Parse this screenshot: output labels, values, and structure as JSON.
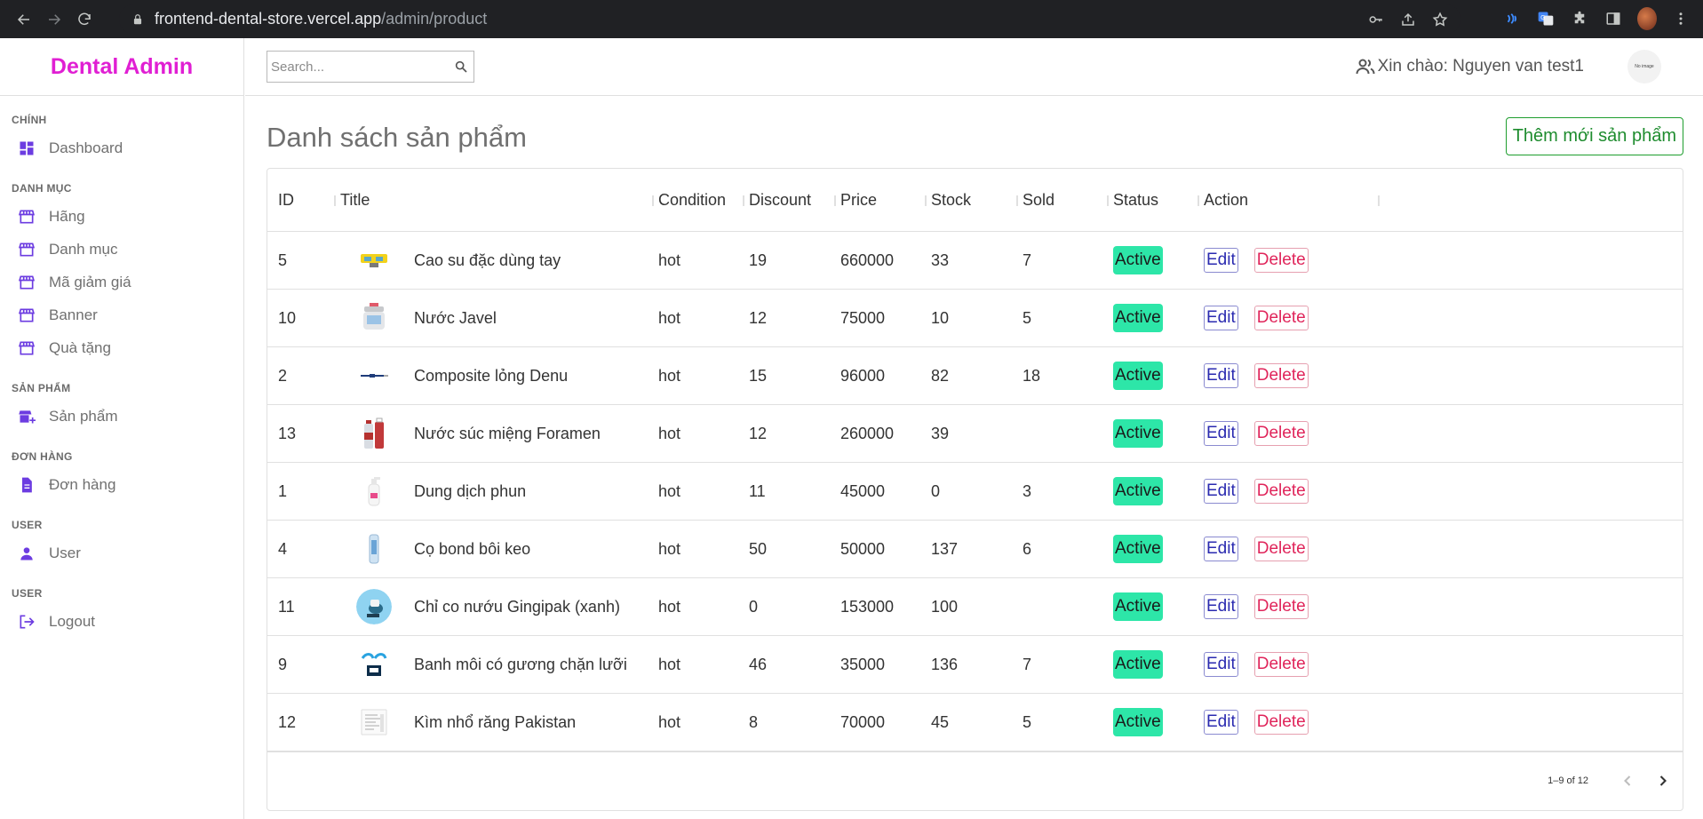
{
  "browser": {
    "url_host": "frontend-dental-store.vercel.app",
    "url_path": "/admin/product"
  },
  "brand": "Dental Admin",
  "sidebar": {
    "sections": [
      {
        "title": "CHÍNH",
        "items": [
          {
            "label": "Dashboard",
            "icon": "dashboard-icon"
          }
        ]
      },
      {
        "title": "DANH MỤC",
        "items": [
          {
            "label": "Hãng",
            "icon": "store-icon"
          },
          {
            "label": "Danh mục",
            "icon": "store-icon"
          },
          {
            "label": "Mã giảm giá",
            "icon": "store-icon"
          },
          {
            "label": "Banner",
            "icon": "store-icon"
          },
          {
            "label": "Quà tặng",
            "icon": "store-icon"
          }
        ]
      },
      {
        "title": "SẢN PHẨM",
        "items": [
          {
            "label": "Sản phẩm",
            "icon": "add-business-icon"
          }
        ]
      },
      {
        "title": "ĐƠN HÀNG",
        "items": [
          {
            "label": "Đơn hàng",
            "icon": "order-icon"
          }
        ]
      },
      {
        "title": "USER",
        "items": [
          {
            "label": "User",
            "icon": "person-icon"
          }
        ]
      },
      {
        "title": "USER",
        "items": [
          {
            "label": "Logout",
            "icon": "logout-icon"
          }
        ]
      }
    ]
  },
  "topbar": {
    "search_placeholder": "Search...",
    "greeting": "Xin chào: Nguyen van test1",
    "avatar_text": "No image"
  },
  "main": {
    "title": "Danh sách sản phẩm",
    "add_button": "Thêm mới sản phẩm"
  },
  "table": {
    "columns": [
      "ID",
      "Title",
      "Condition",
      "Discount",
      "Price",
      "Stock",
      "Sold",
      "Status",
      "Action"
    ],
    "edit_label": "Edit",
    "delete_label": "Delete",
    "rows": [
      {
        "id": "5",
        "title": "Cao su đặc dùng tay",
        "condition": "hot",
        "discount": "19",
        "price": "660000",
        "stock": "33",
        "sold": "7",
        "status": "Active",
        "thumb": "yellow"
      },
      {
        "id": "10",
        "title": "Nước Javel",
        "condition": "hot",
        "discount": "12",
        "price": "75000",
        "stock": "10",
        "sold": "5",
        "status": "Active",
        "thumb": "jar"
      },
      {
        "id": "2",
        "title": "Composite lỏng Denu",
        "condition": "hot",
        "discount": "15",
        "price": "96000",
        "stock": "82",
        "sold": "18",
        "status": "Active",
        "thumb": "syringe"
      },
      {
        "id": "13",
        "title": "Nước súc miệng Foramen",
        "condition": "hot",
        "discount": "12",
        "price": "260000",
        "stock": "39",
        "sold": "",
        "status": "Active",
        "thumb": "bottle"
      },
      {
        "id": "1",
        "title": "Dung dịch phun",
        "condition": "hot",
        "discount": "11",
        "price": "45000",
        "stock": "0",
        "sold": "3",
        "status": "Active",
        "thumb": "spray"
      },
      {
        "id": "4",
        "title": "Cọ bond bôi keo",
        "condition": "hot",
        "discount": "50",
        "price": "50000",
        "stock": "137",
        "sold": "6",
        "status": "Active",
        "thumb": "tube"
      },
      {
        "id": "11",
        "title": "Chỉ co nướu Gingipak (xanh)",
        "condition": "hot",
        "discount": "0",
        "price": "153000",
        "stock": "100",
        "sold": "",
        "status": "Active",
        "thumb": "cord"
      },
      {
        "id": "9",
        "title": "Banh môi có gương chặn lưỡi",
        "condition": "hot",
        "discount": "46",
        "price": "35000",
        "stock": "136",
        "sold": "7",
        "status": "Active",
        "thumb": "retractor"
      },
      {
        "id": "12",
        "title": "Kìm nhổ răng Pakistan",
        "condition": "hot",
        "discount": "8",
        "price": "70000",
        "stock": "45",
        "sold": "5",
        "status": "Active",
        "thumb": "pliers"
      }
    ]
  },
  "pagination": {
    "text": "1–9 of 12"
  },
  "colors": {
    "brand": "#e01fd3",
    "icon": "#6c3ce1",
    "active_badge": "#2de6a8",
    "add_button": "#1e8c2e",
    "delete": "#e0245a",
    "edit": "#2a2ab0"
  }
}
